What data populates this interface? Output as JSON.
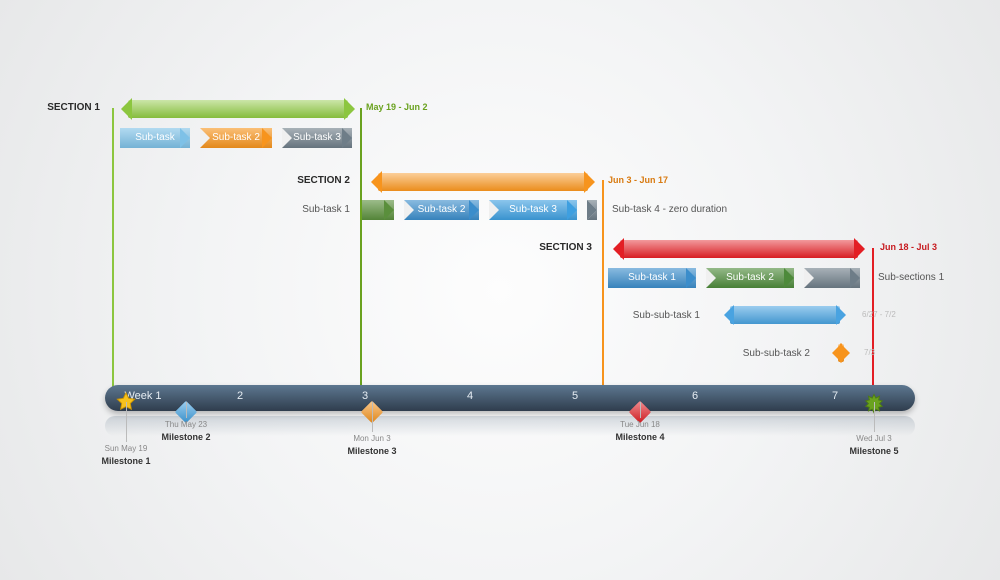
{
  "chart_data": {
    "type": "gantt",
    "time_axis": {
      "unit": "week",
      "start": "2013-05-19",
      "end": "2013-07-03",
      "week_labels": [
        "Week 1",
        "2",
        "3",
        "4",
        "5",
        "6",
        "7"
      ]
    },
    "sections": [
      {
        "name": "SECTION 1",
        "date_range": "May 19 - Jun 2",
        "color": "#8cc63f",
        "start": "2013-05-19",
        "end": "2013-06-02",
        "tasks": [
          {
            "label": "Sub-task",
            "color": "#7ec1e7"
          },
          {
            "label": "Sub-task 2",
            "color": "#f7941d"
          },
          {
            "label": "Sub-task 3",
            "color": "#6e7d88"
          }
        ]
      },
      {
        "name": "SECTION 2",
        "date_range": "Jun 3 - Jun 17",
        "color": "#f7941d",
        "start": "2013-06-03",
        "end": "2013-06-17",
        "left_label": "Sub-task 1",
        "right_label": "Sub-task 4 - zero duration",
        "tasks": [
          {
            "label": "",
            "color": "#5a8f3c"
          },
          {
            "label": "Sub-task 2",
            "color": "#3b8dcb"
          },
          {
            "label": "Sub-task 3",
            "color": "#3e9fe0"
          },
          {
            "label": "",
            "color": "#6e7d88"
          }
        ]
      },
      {
        "name": "SECTION 3",
        "date_range": "Jun 18 - Jul 3",
        "color": "#e31e24",
        "start": "2013-06-18",
        "end": "2013-07-03",
        "right_label": "Sub-sections 1",
        "tasks": [
          {
            "label": "Sub-task 1",
            "color": "#3b8dcb"
          },
          {
            "label": "Sub-task 2",
            "color": "#4d8a3a"
          },
          {
            "label": "",
            "color": "#6e7d88"
          }
        ],
        "sub_sub": [
          {
            "label": "Sub-sub-task 1",
            "date": "6/27 - 7/2",
            "color": "#49a3e1"
          },
          {
            "label": "Sub-sub-task 2",
            "date": "7/3",
            "color": "#f7941d"
          }
        ]
      }
    ],
    "milestones": [
      {
        "name": "Milestone 1",
        "date": "Sun May 19",
        "shape": "star",
        "color": "#f7c21d"
      },
      {
        "name": "Milestone 2",
        "date": "Thu May 23",
        "shape": "diamond",
        "color": "#3e9fe0"
      },
      {
        "name": "Milestone 3",
        "date": "Mon Jun 3",
        "shape": "diamond",
        "color": "#f7941d"
      },
      {
        "name": "Milestone 4",
        "date": "Tue Jun 18",
        "shape": "diamond",
        "color": "#e31e24"
      },
      {
        "name": "Milestone 5",
        "date": "Wed Jul 3",
        "shape": "burst",
        "color": "#6aa21f"
      }
    ]
  }
}
